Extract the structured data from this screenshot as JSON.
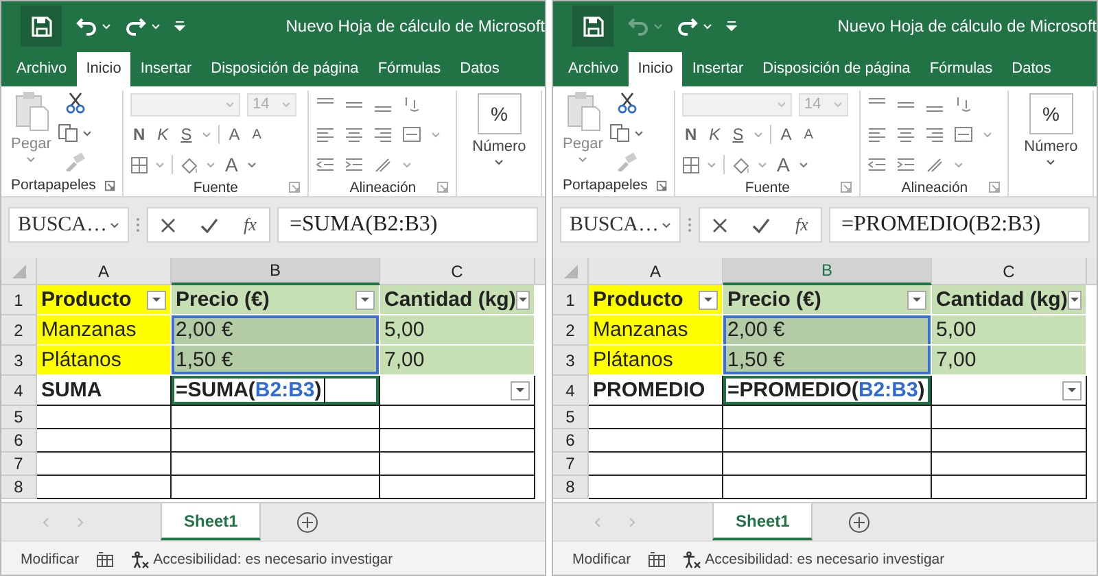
{
  "panes": [
    {
      "title": "Nuevo Hoja de cálculo de Microsoft",
      "undo": {
        "disabled": false
      },
      "tabs": [
        {
          "label": "Archivo",
          "selected": false
        },
        {
          "label": "Inicio",
          "selected": true
        },
        {
          "label": "Insertar",
          "selected": false
        },
        {
          "label": "Disposición de página",
          "selected": false
        },
        {
          "label": "Fórmulas",
          "selected": false
        },
        {
          "label": "Datos",
          "selected": false
        }
      ],
      "ribbon": {
        "paste": "Pegar",
        "font_size": "14",
        "font_buttons": [
          {
            "label": "N",
            "kind": "bold"
          },
          {
            "label": "K",
            "kind": "italic"
          },
          {
            "label": "S",
            "kind": "underline"
          }
        ],
        "grow": "A",
        "shrink": "A",
        "font_color": "A",
        "number_symbol": "%",
        "number_label": "Número",
        "groups": [
          "Portapapeles",
          "Fuente",
          "Alineación"
        ]
      },
      "name_box": "BUSCA…",
      "function_label": "fx",
      "formula": "=SUMA(B2:B3)",
      "columns": [
        {
          "label": "A",
          "selected": false
        },
        {
          "label": "B",
          "selected": true
        },
        {
          "label": "C",
          "selected": false
        }
      ],
      "rows": [
        {
          "number": "1",
          "cells": [
            {
              "text": "Producto",
              "color": "#ffff00",
              "bold": true,
              "filter": true,
              "selected": false,
              "editing": false
            },
            {
              "text": "Precio (€)",
              "color": "#c6e0b4",
              "bold": true,
              "filter": true,
              "selected": false,
              "editing": false
            },
            {
              "text": "Cantidad (kg)",
              "color": "#c6e0b4",
              "bold": true,
              "filter": true,
              "selected": false,
              "editing": false
            }
          ]
        },
        {
          "number": "2",
          "cells": [
            {
              "text": "Manzanas",
              "color": "#ffff00",
              "selected": false,
              "editing": false
            },
            {
              "text": "2,00 €",
              "color": "#b4cca6",
              "selected": true,
              "editing": false
            },
            {
              "text": "5,00",
              "color": "#c6e0b4",
              "selected": false,
              "editing": false
            }
          ]
        },
        {
          "number": "3",
          "cells": [
            {
              "text": "Plátanos",
              "color": "#ffff00",
              "selected": false,
              "editing": false
            },
            {
              "text": "1,50 €",
              "color": "#b4cca6",
              "selected": true,
              "editing": false
            },
            {
              "text": "7,00",
              "color": "#c6e0b4",
              "selected": false,
              "editing": false
            }
          ]
        },
        {
          "number": "4",
          "cells": [
            {
              "text": "SUMA",
              "bold": true,
              "selected": false,
              "editing": false
            },
            {
              "parts": [
                {
                  "text": "=SUMA(",
                  "kind": "plain"
                },
                {
                  "text": "B2:B3",
                  "kind": "reference"
                },
                {
                  "text": ")",
                  "kind": "plain"
                }
              ],
              "bold": true,
              "selected": false,
              "editing": true
            },
            {
              "dropdown": true,
              "selected": false,
              "editing": false
            }
          ]
        },
        {
          "number": "5"
        },
        {
          "number": "6"
        },
        {
          "number": "7"
        },
        {
          "number": "8"
        }
      ],
      "sheet_tab": "Sheet1",
      "status": "Modificar",
      "accessibility": "Accesibilidad: es necesario investigar"
    },
    {
      "title": "Nuevo Hoja de cálculo de Microsoft",
      "undo": {
        "disabled": true
      },
      "tabs": [
        {
          "label": "Archivo",
          "selected": false
        },
        {
          "label": "Inicio",
          "selected": true
        },
        {
          "label": "Insertar",
          "selected": false
        },
        {
          "label": "Disposición de página",
          "selected": false
        },
        {
          "label": "Fórmulas",
          "selected": false
        },
        {
          "label": "Datos",
          "selected": false
        }
      ],
      "ribbon": {
        "paste": "Pegar",
        "font_size": "14",
        "font_buttons": [
          {
            "label": "N",
            "kind": "bold"
          },
          {
            "label": "K",
            "kind": "italic"
          },
          {
            "label": "S",
            "kind": "underline"
          }
        ],
        "grow": "A",
        "shrink": "A",
        "font_color": "A",
        "number_symbol": "%",
        "number_label": "Número",
        "groups": [
          "Portapapeles",
          "Fuente",
          "Alineación"
        ]
      },
      "name_box": "BUSCA…",
      "function_label": "fx",
      "formula": "=PROMEDIO(B2:B3)",
      "columns": [
        {
          "label": "A",
          "selected": false
        },
        {
          "label": "B",
          "selected": true
        },
        {
          "label": "C",
          "selected": false
        }
      ],
      "rows": [
        {
          "number": "1",
          "cells": [
            {
              "text": "Producto",
              "color": "#ffff00",
              "bold": true,
              "filter": true,
              "selected": false,
              "editing": false
            },
            {
              "text": "Precio (€)",
              "color": "#c6e0b4",
              "bold": true,
              "filter": true,
              "selected": false,
              "editing": false
            },
            {
              "text": "Cantidad (kg)",
              "color": "#c6e0b4",
              "bold": true,
              "filter": true,
              "selected": false,
              "editing": false
            }
          ]
        },
        {
          "number": "2",
          "cells": [
            {
              "text": "Manzanas",
              "color": "#ffff00",
              "selected": false,
              "editing": false
            },
            {
              "text": "2,00 €",
              "color": "#b4cca6",
              "selected": true,
              "editing": false
            },
            {
              "text": "5,00",
              "color": "#c6e0b4",
              "selected": false,
              "editing": false
            }
          ]
        },
        {
          "number": "3",
          "cells": [
            {
              "text": "Plátanos",
              "color": "#ffff00",
              "selected": false,
              "editing": false
            },
            {
              "text": "1,50 €",
              "color": "#b4cca6",
              "selected": true,
              "editing": false
            },
            {
              "text": "7,00",
              "color": "#c6e0b4",
              "selected": false,
              "editing": false
            }
          ]
        },
        {
          "number": "4",
          "cells": [
            {
              "text": "PROMEDIO",
              "bold": true,
              "selected": false,
              "editing": false
            },
            {
              "parts": [
                {
                  "text": "=PROMEDIO(",
                  "kind": "plain"
                },
                {
                  "text": "B2:B3",
                  "kind": "reference"
                },
                {
                  "text": ")",
                  "kind": "plain"
                }
              ],
              "bold": true,
              "selected": false,
              "editing": true
            },
            {
              "dropdown": true,
              "selected": false,
              "editing": false
            }
          ]
        },
        {
          "number": "5"
        },
        {
          "number": "6"
        },
        {
          "number": "7"
        },
        {
          "number": "8"
        }
      ],
      "sheet_tab": "Sheet1",
      "status": "Modificar",
      "accessibility": "Accesibilidad: es necesario investigar"
    }
  ]
}
